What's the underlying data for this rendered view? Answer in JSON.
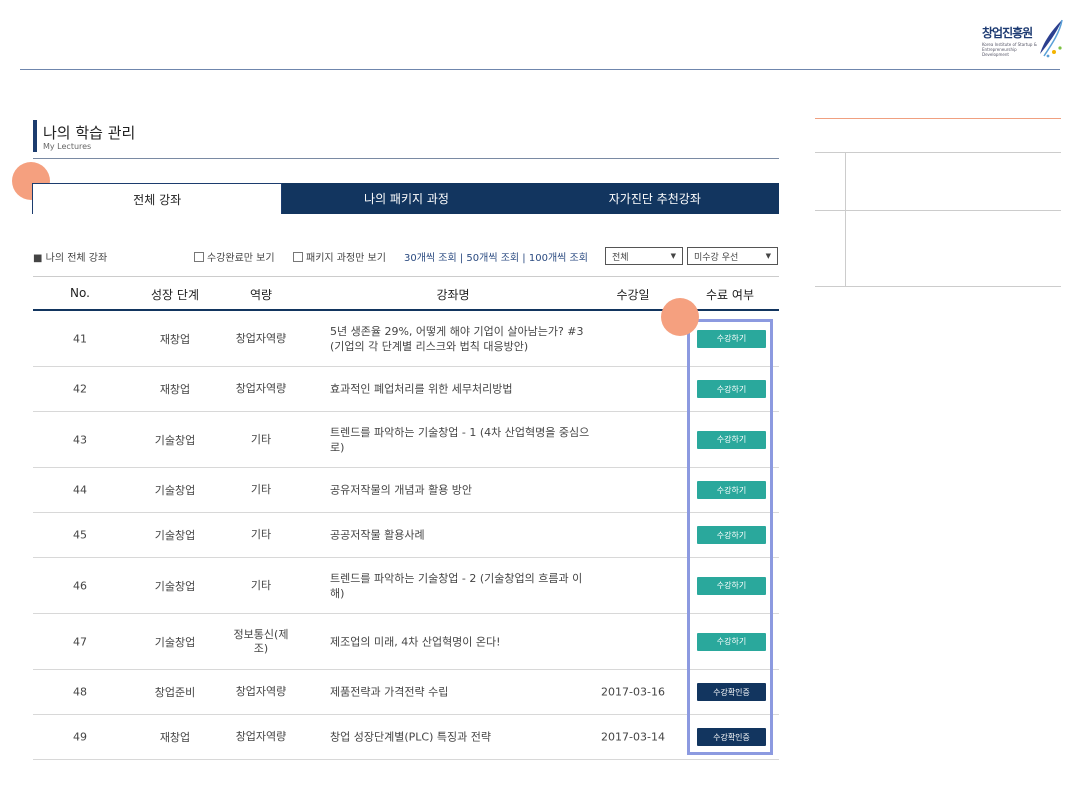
{
  "logo": {
    "title": "창업진흥원",
    "sub": "Korea Institute of Startup & Entrepreneurship Development"
  },
  "header": {
    "title": "나의 학습 관리",
    "subtitle": "My Lectures"
  },
  "tabs": [
    {
      "label": "전체 강좌",
      "active": true
    },
    {
      "label": "나의 패키지 과정",
      "active": false
    },
    {
      "label": "자가진단 추천강좌",
      "active": false
    }
  ],
  "filters": {
    "section_label": "■ 나의 전체 강좌",
    "check_completed": "수강완료만 보기",
    "check_package": "패키지 과정만 보기",
    "view_links": "30개씩 조회 | 50개씩 조회 | 100개씩 조회",
    "select_all": "전체",
    "select_sort": "미수강 우선"
  },
  "table": {
    "headers": {
      "no": "No.",
      "stage": "성장 단계",
      "skill": "역량",
      "course": "강좌명",
      "date": "수강일",
      "status": "수료 여부"
    },
    "rows": [
      {
        "no": "41",
        "stage": "재창업",
        "skill": "창업자역량",
        "title": "5년 생존율 29%, 어떻게 해야 기업이 살아남는가? #3 (기업의 각 단계별 리스크와 법칙 대응방안)",
        "date": "",
        "action": "수강하기",
        "style": "teal"
      },
      {
        "no": "42",
        "stage": "재창업",
        "skill": "창업자역량",
        "title": "효과적인 폐업처리를 위한 세무처리방법",
        "date": "",
        "action": "수강하기",
        "style": "teal"
      },
      {
        "no": "43",
        "stage": "기술창업",
        "skill": "기타",
        "title": "트렌드를 파악하는 기술창업 - 1 (4차 산업혁명을 중심으로)",
        "date": "",
        "action": "수강하기",
        "style": "teal"
      },
      {
        "no": "44",
        "stage": "기술창업",
        "skill": "기타",
        "title": "공유저작물의 개념과 활용 방안",
        "date": "",
        "action": "수강하기",
        "style": "teal"
      },
      {
        "no": "45",
        "stage": "기술창업",
        "skill": "기타",
        "title": "공공저작물 활용사례",
        "date": "",
        "action": "수강하기",
        "style": "teal"
      },
      {
        "no": "46",
        "stage": "기술창업",
        "skill": "기타",
        "title": "트렌드를 파악하는 기술창업 - 2 (기술창업의 흐름과 이해)",
        "date": "",
        "action": "수강하기",
        "style": "teal"
      },
      {
        "no": "47",
        "stage": "기술창업",
        "skill": "정보통신(제조)",
        "title": "제조업의 미래, 4차 산업혁명이 온다!",
        "date": "",
        "action": "수강하기",
        "style": "teal"
      },
      {
        "no": "48",
        "stage": "창업준비",
        "skill": "창업자역량",
        "title": "제품전략과 가격전략 수립",
        "date": "2017-03-16",
        "action": "수강확인증",
        "style": "navy"
      },
      {
        "no": "49",
        "stage": "재창업",
        "skill": "창업자역량",
        "title": "창업 성장단계별(PLC) 특징과 전략",
        "date": "2017-03-14",
        "action": "수강확인증",
        "style": "navy"
      }
    ]
  }
}
